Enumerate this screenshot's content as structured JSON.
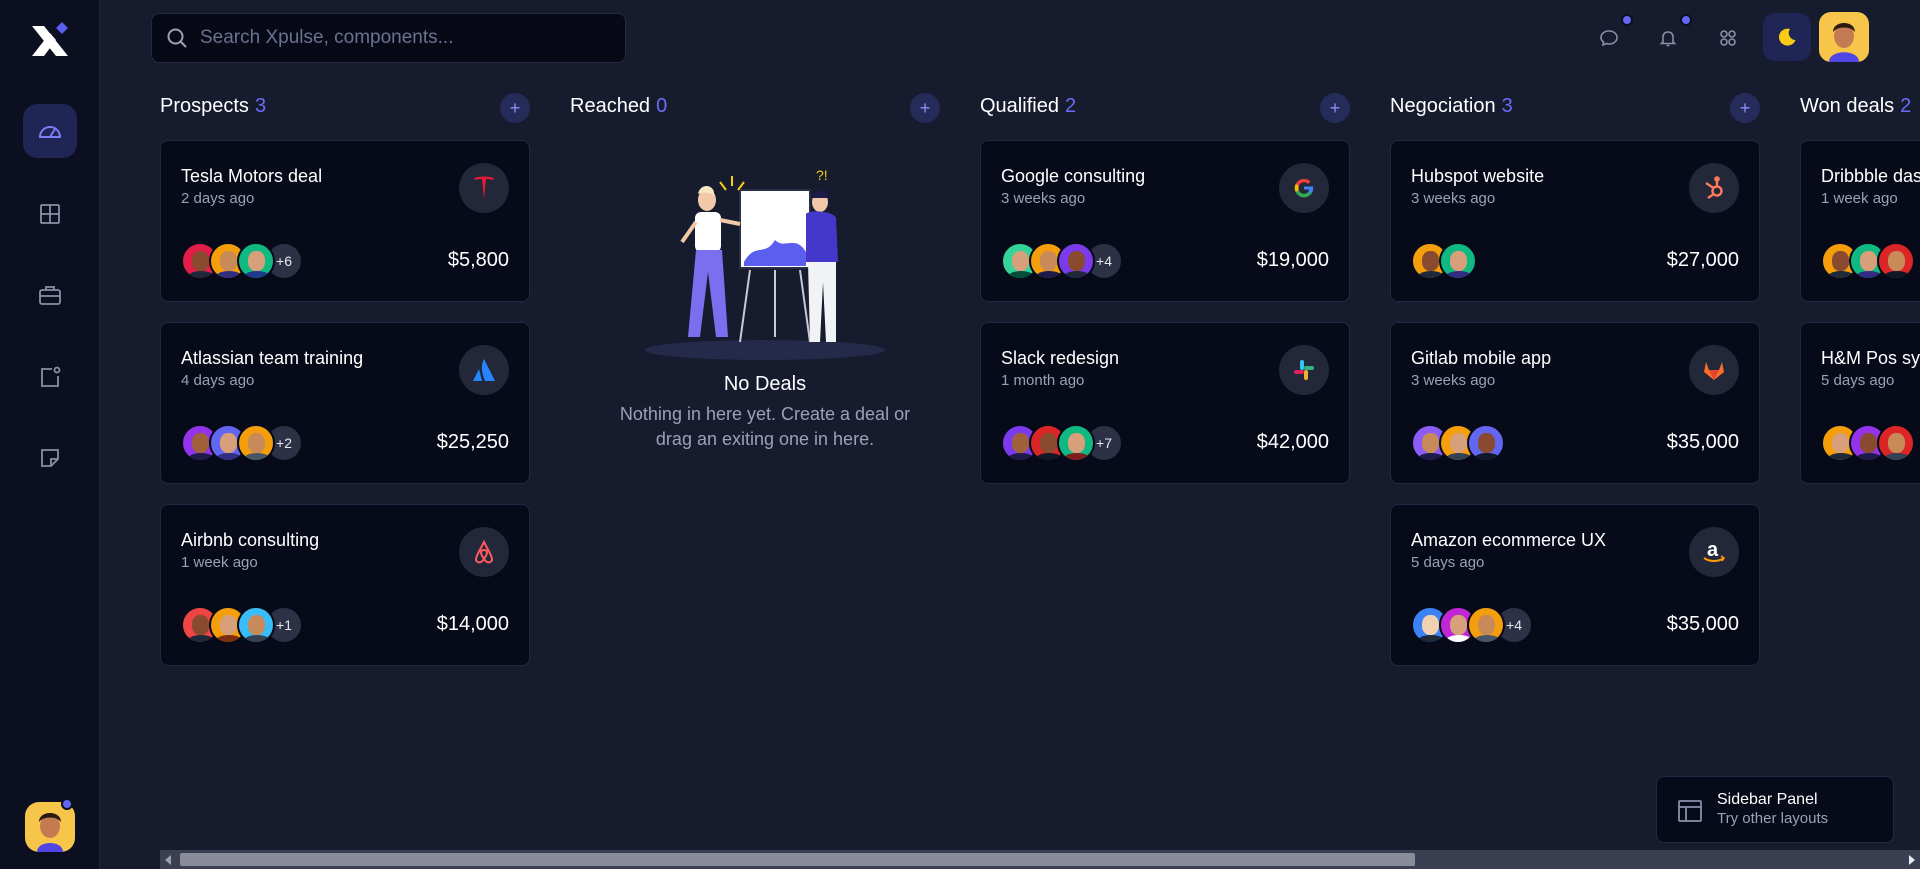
{
  "search": {
    "placeholder": "Search Xpulse, components..."
  },
  "topbar": {
    "icons": [
      "chat-icon",
      "bell-icon",
      "grid-icon",
      "moon-icon"
    ]
  },
  "sidebar": {
    "items": [
      "dashboard-icon",
      "layout-icon",
      "briefcase-icon",
      "notification-icon",
      "sticky-note-icon"
    ]
  },
  "columns": [
    {
      "title": "Prospects",
      "count": "3",
      "cards": [
        {
          "title": "Tesla Motors deal",
          "time": "2 days ago",
          "amount": "$5,800",
          "logo": "tesla-logo",
          "more": "+6"
        },
        {
          "title": "Atlassian team training",
          "time": "4 days ago",
          "amount": "$25,250",
          "logo": "atlassian-logo",
          "more": "+2"
        },
        {
          "title": "Airbnb consulting",
          "time": "1 week ago",
          "amount": "$14,000",
          "logo": "airbnb-logo",
          "more": "+1"
        }
      ]
    },
    {
      "title": "Reached",
      "count": "0",
      "empty": {
        "title": "No Deals",
        "text": "Nothing in here yet. Create a deal or drag an exiting one in here."
      }
    },
    {
      "title": "Qualified",
      "count": "2",
      "cards": [
        {
          "title": "Google consulting",
          "time": "3 weeks ago",
          "amount": "$19,000",
          "logo": "google-logo",
          "more": "+4"
        },
        {
          "title": "Slack redesign",
          "time": "1 month ago",
          "amount": "$42,000",
          "logo": "slack-logo",
          "more": "+7"
        }
      ]
    },
    {
      "title": "Negociation",
      "count": "3",
      "cards": [
        {
          "title": "Hubspot website",
          "time": "3 weeks ago",
          "amount": "$27,000",
          "logo": "hubspot-logo",
          "more": ""
        },
        {
          "title": "Gitlab mobile app",
          "time": "3 weeks ago",
          "amount": "$35,000",
          "logo": "gitlab-logo",
          "more": ""
        },
        {
          "title": "Amazon ecommerce UX",
          "time": "5 days ago",
          "amount": "$35,000",
          "logo": "amazon-logo",
          "more": "+4"
        }
      ]
    },
    {
      "title": "Won deals",
      "count": "2",
      "cards": [
        {
          "title": "Dribbble dashboard",
          "time": "1 week ago"
        },
        {
          "title": "H&M Pos system",
          "time": "5 days ago"
        }
      ]
    }
  ],
  "panel_switch": {
    "title": "Sidebar Panel",
    "subtitle": "Try other layouts"
  },
  "colors": {
    "background": "#161b2e",
    "card": "#070a18",
    "accent": "#6366f1",
    "count": "#6b6cf5"
  }
}
